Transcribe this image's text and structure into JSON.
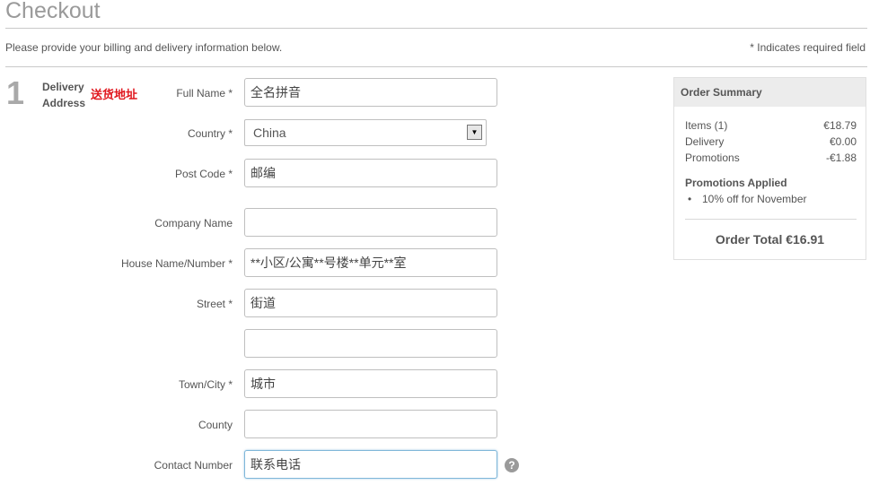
{
  "page": {
    "title": "Checkout",
    "intro": "Please provide your billing and delivery information below.",
    "required_note": "* Indicates required field"
  },
  "step": {
    "number": "1",
    "title_line1": "Delivery",
    "title_line2": "Address",
    "annotation": "送货地址"
  },
  "form": {
    "full_name": {
      "label": "Full Name *",
      "value": "全名拼音"
    },
    "country": {
      "label": "Country *",
      "value": "China"
    },
    "post_code": {
      "label": "Post Code *",
      "value": "邮编"
    },
    "company_name": {
      "label": "Company Name",
      "value": ""
    },
    "house_name": {
      "label": "House Name/Number *",
      "value": "**小区/公寓**号楼**单元**室"
    },
    "street": {
      "label": "Street *",
      "value": "街道"
    },
    "street2": {
      "value": ""
    },
    "town_city": {
      "label": "Town/City *",
      "value": "城市"
    },
    "county": {
      "label": "County",
      "value": ""
    },
    "contact_number": {
      "label": "Contact Number",
      "value": "联系电话"
    },
    "help_icon": "?"
  },
  "summary": {
    "title": "Order Summary",
    "rows": [
      {
        "label": "Items (1)",
        "value": "€18.79"
      },
      {
        "label": "Delivery",
        "value": "€0.00"
      },
      {
        "label": "Promotions",
        "value": "-€1.88"
      }
    ],
    "promotions_title": "Promotions Applied",
    "promotions": [
      "10% off for November"
    ],
    "bullet": "•",
    "total": "Order Total €16.91"
  },
  "colors": {
    "annotation": "#e0161d",
    "title": "#9a9a9a",
    "focus_border": "#7fb7d9"
  },
  "icons": {
    "dropdown": "chevron-down-icon",
    "help": "help-circle-icon"
  }
}
